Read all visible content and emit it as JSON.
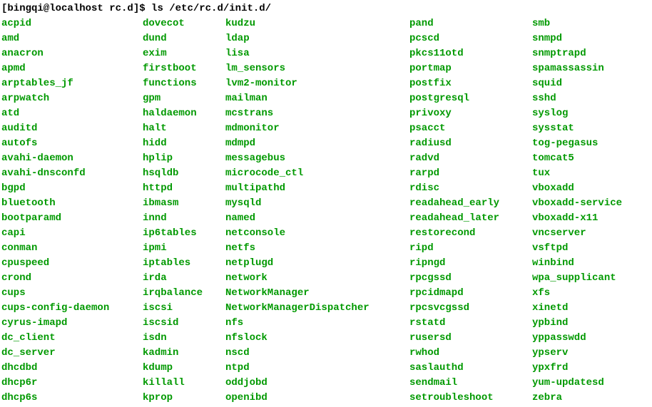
{
  "prompt": {
    "user_host": "[bingqi@localhost rc.d]$ ",
    "command": "ls /etc/rc.d/init.d/"
  },
  "columns": [
    [
      "acpid",
      "amd",
      "anacron",
      "apmd",
      "arptables_jf",
      "arpwatch",
      "atd",
      "auditd",
      "autofs",
      "avahi-daemon",
      "avahi-dnsconfd",
      "bgpd",
      "bluetooth",
      "bootparamd",
      "capi",
      "conman",
      "cpuspeed",
      "crond",
      "cups",
      "cups-config-daemon",
      "cyrus-imapd",
      "dc_client",
      "dc_server",
      "dhcdbd",
      "dhcp6r",
      "dhcp6s"
    ],
    [
      "dovecot",
      "dund",
      "exim",
      "firstboot",
      "functions",
      "gpm",
      "haldaemon",
      "halt",
      "hidd",
      "hplip",
      "hsqldb",
      "httpd",
      "ibmasm",
      "innd",
      "ip6tables",
      "ipmi",
      "iptables",
      "irda",
      "irqbalance",
      "iscsi",
      "iscsid",
      "isdn",
      "kadmin",
      "kdump",
      "killall",
      "kprop"
    ],
    [
      "kudzu",
      "ldap",
      "lisa",
      "lm_sensors",
      "lvm2-monitor",
      "mailman",
      "mcstrans",
      "mdmonitor",
      "mdmpd",
      "messagebus",
      "microcode_ctl",
      "multipathd",
      "mysqld",
      "named",
      "netconsole",
      "netfs",
      "netplugd",
      "network",
      "NetworkManager",
      "NetworkManagerDispatcher",
      "nfs",
      "nfslock",
      "nscd",
      "ntpd",
      "oddjobd",
      "openibd"
    ],
    [
      "pand",
      "pcscd",
      "pkcs11otd",
      "portmap",
      "postfix",
      "postgresql",
      "privoxy",
      "psacct",
      "radiusd",
      "radvd",
      "rarpd",
      "rdisc",
      "readahead_early",
      "readahead_later",
      "restorecond",
      "ripd",
      "ripngd",
      "rpcgssd",
      "rpcidmapd",
      "rpcsvcgssd",
      "rstatd",
      "rusersd",
      "rwhod",
      "saslauthd",
      "sendmail",
      "setroubleshoot"
    ],
    [
      "smb",
      "snmpd",
      "snmptrapd",
      "spamassassin",
      "squid",
      "sshd",
      "syslog",
      "sysstat",
      "tog-pegasus",
      "tomcat5",
      "tux",
      "vboxadd",
      "vboxadd-service",
      "vboxadd-x11",
      "vncserver",
      "vsftpd",
      "winbind",
      "wpa_supplicant",
      "xfs",
      "xinetd",
      "ypbind",
      "yppasswdd",
      "ypserv",
      "ypxfrd",
      "yum-updatesd",
      "zebra"
    ]
  ]
}
